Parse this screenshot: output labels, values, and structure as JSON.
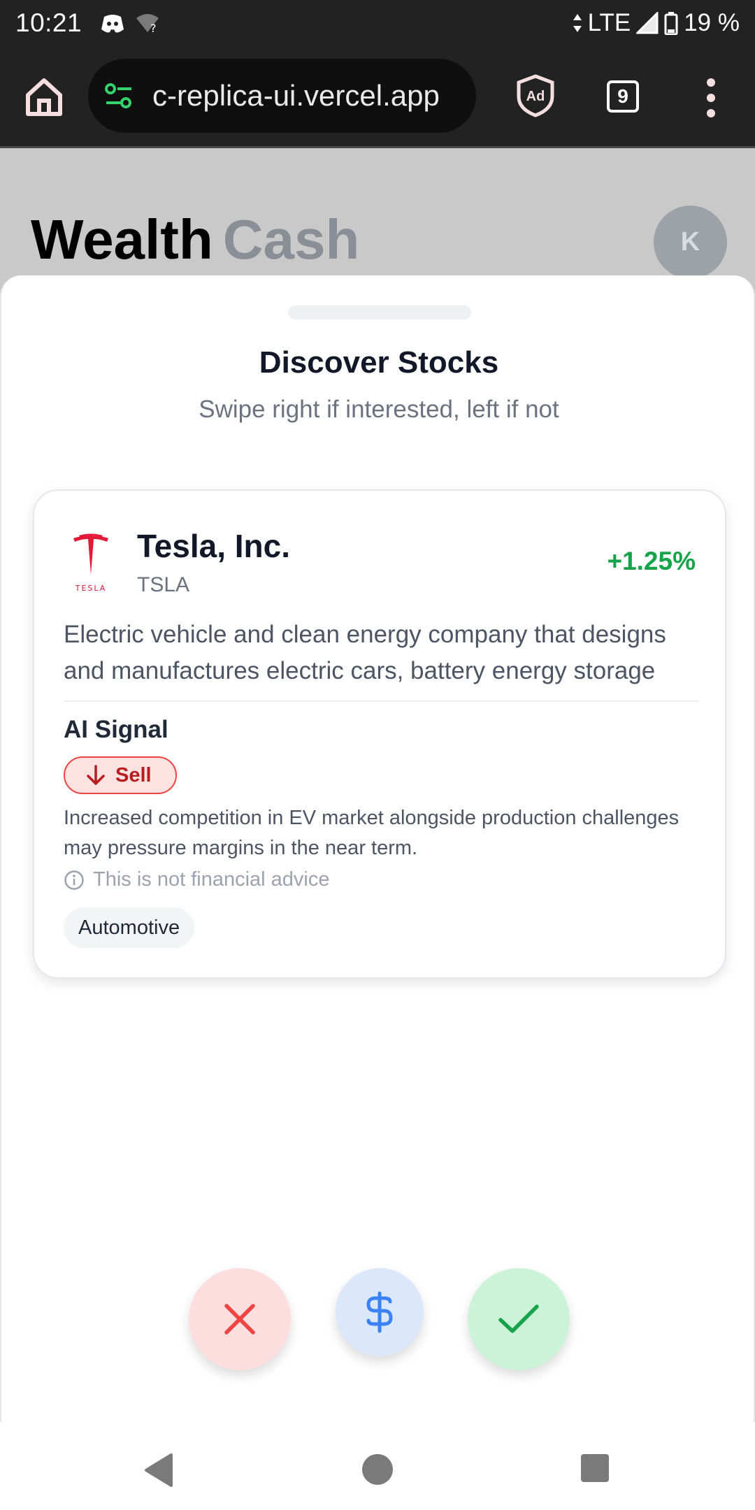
{
  "status_bar": {
    "time": "10:21",
    "network": "LTE",
    "battery": "19 %",
    "icons": [
      "discord-icon",
      "wifi-question-icon",
      "data-arrows-icon",
      "signal-icon",
      "battery-icon"
    ]
  },
  "browser": {
    "url": "c-replica-ui.vercel.app",
    "tab_count": "9",
    "icons": [
      "home-icon",
      "site-settings-icon",
      "adblock-shield-icon",
      "tabs-icon",
      "more-vert-icon"
    ]
  },
  "page": {
    "title_primary": "Wealth",
    "title_secondary": "Cash",
    "avatar_initial": "K"
  },
  "sheet": {
    "title": "Discover Stocks",
    "subtitle": "Swipe right if interested, left if not"
  },
  "stock": {
    "logo_text": "TESLA",
    "name": "Tesla, Inc.",
    "ticker": "TSLA",
    "change": "+1.25%",
    "description": "Electric vehicle and clean energy company that designs and manufactures electric cars, battery energy storage",
    "signal_heading": "AI Signal",
    "signal": "Sell",
    "signal_reason": "Increased competition in EV market alongside production challenges may pressure margins in the near term.",
    "disclaimer": "This is not financial advice",
    "sector": "Automotive"
  },
  "actions": {
    "pass_icon": "x-icon",
    "invest_icon": "dollar-icon",
    "like_icon": "check-icon"
  },
  "colors": {
    "positive": "#16a34a",
    "sell": "#b91c1c",
    "pass_bg": "#fddede",
    "invest_bg": "#dbe7fb",
    "like_bg": "#ccf3d8"
  }
}
